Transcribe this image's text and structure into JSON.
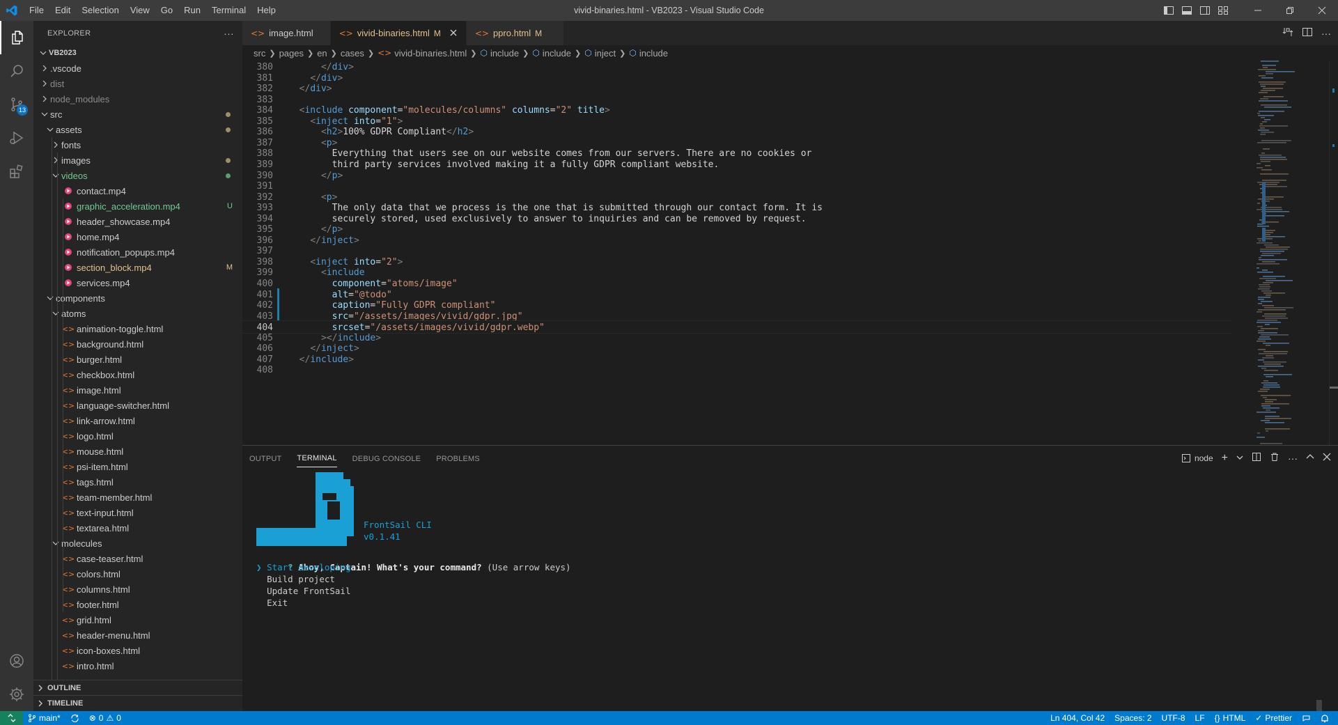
{
  "titlebar": {
    "menu": [
      "File",
      "Edit",
      "Selection",
      "View",
      "Go",
      "Run",
      "Terminal",
      "Help"
    ],
    "window_title": "vivid-binaries.html - VB2023 - Visual Studio Code"
  },
  "activity": {
    "scm_badge": "13"
  },
  "explorer": {
    "title": "EXPLORER",
    "more": "···",
    "root": "VB2023",
    "items": [
      {
        "label": "vscode_dot",
        "text": ".vscode",
        "color": "#cccccc"
      },
      {
        "text": "dist",
        "color": "#8c8c8c"
      },
      {
        "text": "node_modules",
        "color": "#8c8c8c"
      },
      {
        "text": "src",
        "color": "#cccccc"
      },
      {
        "text": "assets",
        "color": "#cccccc"
      },
      {
        "text": "fonts",
        "color": "#cccccc"
      },
      {
        "text": "images",
        "color": "#cccccc"
      },
      {
        "text": "videos",
        "color": "#73c991"
      },
      {
        "text": "contact.mp4",
        "color": "#cccccc"
      },
      {
        "text": "graphic_acceleration.mp4",
        "color": "#73c991",
        "decoration": "U"
      },
      {
        "text": "header_showcase.mp4",
        "color": "#cccccc"
      },
      {
        "text": "home.mp4",
        "color": "#cccccc"
      },
      {
        "text": "notification_popups.mp4",
        "color": "#cccccc"
      },
      {
        "text": "section_block.mp4",
        "color": "#e2c08d",
        "decoration": "M"
      },
      {
        "text": "services.mp4",
        "color": "#cccccc"
      },
      {
        "text": "components",
        "color": "#cccccc"
      },
      {
        "text": "atoms",
        "color": "#cccccc"
      },
      {
        "text": "animation-toggle.html",
        "color": "#cccccc"
      },
      {
        "text": "background.html",
        "color": "#cccccc"
      },
      {
        "text": "burger.html",
        "color": "#cccccc"
      },
      {
        "text": "checkbox.html",
        "color": "#cccccc"
      },
      {
        "text": "image.html",
        "color": "#cccccc"
      },
      {
        "text": "language-switcher.html",
        "color": "#cccccc"
      },
      {
        "text": "link-arrow.html",
        "color": "#cccccc"
      },
      {
        "text": "logo.html",
        "color": "#cccccc"
      },
      {
        "text": "mouse.html",
        "color": "#cccccc"
      },
      {
        "text": "psi-item.html",
        "color": "#cccccc"
      },
      {
        "text": "tags.html",
        "color": "#cccccc"
      },
      {
        "text": "team-member.html",
        "color": "#cccccc"
      },
      {
        "text": "text-input.html",
        "color": "#cccccc"
      },
      {
        "text": "textarea.html",
        "color": "#cccccc"
      },
      {
        "text": "molecules",
        "color": "#cccccc"
      },
      {
        "text": "case-teaser.html",
        "color": "#cccccc"
      },
      {
        "text": "colors.html",
        "color": "#cccccc"
      },
      {
        "text": "columns.html",
        "color": "#cccccc"
      },
      {
        "text": "footer.html",
        "color": "#cccccc"
      },
      {
        "text": "grid.html",
        "color": "#cccccc"
      },
      {
        "text": "header-menu.html",
        "color": "#cccccc"
      },
      {
        "text": "icon-boxes.html",
        "color": "#cccccc"
      },
      {
        "text": "intro.html",
        "color": "#cccccc"
      }
    ],
    "outline": "OUTLINE",
    "timeline": "TIMELINE"
  },
  "tabs": [
    {
      "label": "image.html",
      "modified": "",
      "active": false,
      "color": "#cccccc"
    },
    {
      "label": "vivid-binaries.html",
      "modified": "M",
      "active": true,
      "color": "#e2c08d"
    },
    {
      "label": "ppro.html",
      "modified": "M",
      "active": false,
      "color": "#e2c08d"
    }
  ],
  "breadcrumb": [
    "src",
    "pages",
    "en",
    "cases",
    "vivid-binaries.html",
    "include",
    "include",
    "inject",
    "include"
  ],
  "editor": {
    "lines": [
      {
        "n": "380",
        "code": "      </div>"
      },
      {
        "n": "381",
        "code": "    </div>"
      },
      {
        "n": "382",
        "code": "  </div>"
      },
      {
        "n": "383",
        "code": ""
      },
      {
        "n": "384",
        "code": "  <include component=\"molecules/columns\" columns=\"2\" title>"
      },
      {
        "n": "385",
        "code": "    <inject into=\"1\">"
      },
      {
        "n": "386",
        "code": "      <h2>100% GDPR Compliant</h2>"
      },
      {
        "n": "387",
        "code": "      <p>"
      },
      {
        "n": "388",
        "code": "        Everything that users see on our website comes from our servers. There are no cookies or"
      },
      {
        "n": "389",
        "code": "        third party services involved making it a fully GDPR compliant website."
      },
      {
        "n": "390",
        "code": "      </p>"
      },
      {
        "n": "391",
        "code": ""
      },
      {
        "n": "392",
        "code": "      <p>"
      },
      {
        "n": "393",
        "code": "        The only data that we process is the one that is submitted through our contact form. It is"
      },
      {
        "n": "394",
        "code": "        securely stored, used exclusively to answer to inquiries and can be removed by request."
      },
      {
        "n": "395",
        "code": "      </p>"
      },
      {
        "n": "396",
        "code": "    </inject>"
      },
      {
        "n": "397",
        "code": ""
      },
      {
        "n": "398",
        "code": "    <inject into=\"2\">"
      },
      {
        "n": "399",
        "code": "      <include"
      },
      {
        "n": "400",
        "code": "        component=\"atoms/image\""
      },
      {
        "n": "401",
        "code": "        alt=\"@todo\""
      },
      {
        "n": "402",
        "code": "        caption=\"Fully GDPR compliant\""
      },
      {
        "n": "403",
        "code": "        src=\"/assets/images/vivid/gdpr.jpg\""
      },
      {
        "n": "404",
        "code": "        srcset=\"/assets/images/vivid/gdpr.webp\""
      },
      {
        "n": "405",
        "code": "      ></include>"
      },
      {
        "n": "406",
        "code": "    </inject>"
      },
      {
        "n": "407",
        "code": "  </include>"
      },
      {
        "n": "408",
        "code": ""
      }
    ],
    "current_line": "404"
  },
  "panel": {
    "tabs": [
      "OUTPUT",
      "TERMINAL",
      "DEBUG CONSOLE",
      "PROBLEMS"
    ],
    "active_tab": "TERMINAL",
    "shell": "node"
  },
  "terminal": {
    "brand": "FrontSail CLI",
    "version": "v0.1.41",
    "prompt_mark": "?",
    "question": "Ahoy, Captain! What's your command?",
    "hint": "(Use arrow keys)",
    "pointer": "❯",
    "options": [
      "Start developing",
      "Build project",
      "Update FrontSail",
      "Exit"
    ],
    "accent": "#1ba0d6"
  },
  "statusbar": {
    "branch": "main*",
    "errors": "0",
    "warnings": "0",
    "position": "Ln 404, Col 42",
    "spaces": "Spaces: 2",
    "encoding": "UTF-8",
    "eol": "LF",
    "language": "HTML",
    "formatter": "Prettier"
  }
}
